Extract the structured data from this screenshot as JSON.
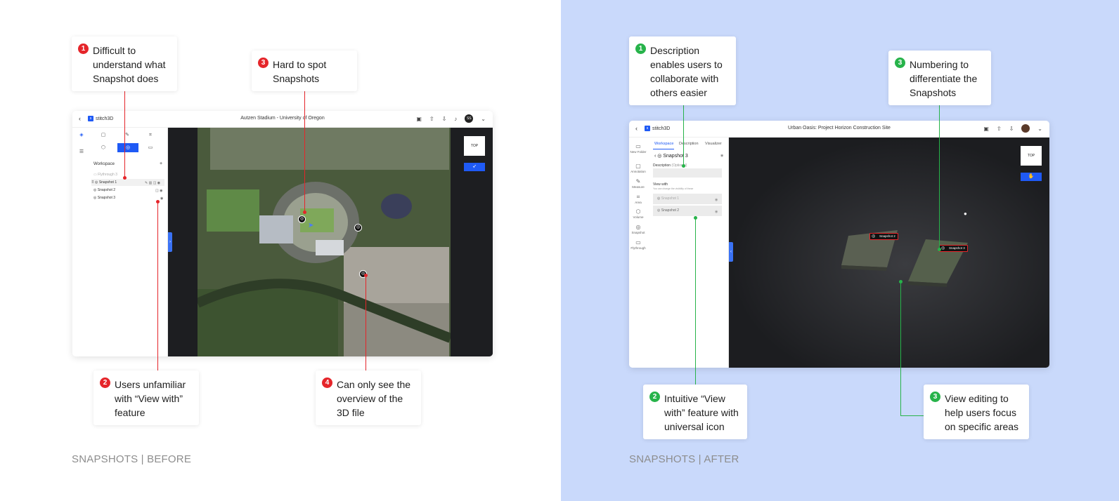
{
  "before": {
    "caption": "SNAPSHOTS | BEFORE",
    "callouts": [
      {
        "num": "1",
        "text": "Difficult to understand what Snapshot does"
      },
      {
        "num": "2",
        "text": "Users unfamiliar with “View with” feature"
      },
      {
        "num": "3",
        "text": "Hard to spot Snapshots"
      },
      {
        "num": "4",
        "text": "Can only see the overview of the 3D file"
      }
    ],
    "app": {
      "logo": "stitch3D",
      "logo_mark": "s",
      "title": "Autzen Stadium - University of Oregon",
      "avatar": "SS",
      "workspace_label": "Workspace",
      "add": "+",
      "rows": [
        "Flythrough 3",
        "Snapshot 1",
        "Snapshot 2",
        "Snapshot 3"
      ],
      "top_button": "TOP"
    }
  },
  "after": {
    "caption": "SNAPSHOTS | AFTER",
    "callouts": [
      {
        "num": "1",
        "text": "Description enables users to collaborate with others easier"
      },
      {
        "num": "2",
        "text": "Intuitive “View with” feature with universal icon"
      },
      {
        "num": "3",
        "text": "Numbering to differentiate the Snapshots"
      },
      {
        "num": "3",
        "text": "View editing to help users focus on specific areas"
      }
    ],
    "app": {
      "logo": "stitch3D",
      "logo_mark": "s",
      "title": "Urban Oasis: Project Horizon Construction Site",
      "tabs": [
        "Workspace",
        "Description",
        "Visualizer"
      ],
      "snapshot_title": "Snapshot 3",
      "description_label": "Description",
      "description_hint": "(Optional)",
      "view_with_label": "View with",
      "view_with_hint": "You can change the visibility of these",
      "view_rows": [
        "Snapshot 1",
        "Snapshot 2"
      ],
      "side_items": [
        "New Folder",
        "Annotation",
        "Measure",
        "Area",
        "Volume",
        "Snapshot",
        "Flythrough"
      ],
      "tags": [
        "Snapshot 2",
        "Snapshot 3"
      ],
      "top_button": "TOP"
    }
  },
  "icons": {
    "back": "‹",
    "camera": "◎",
    "eye": "◉",
    "save": "▣",
    "share": "⇧",
    "download": "⇩",
    "bell": "♪",
    "chevron": "⌄"
  }
}
